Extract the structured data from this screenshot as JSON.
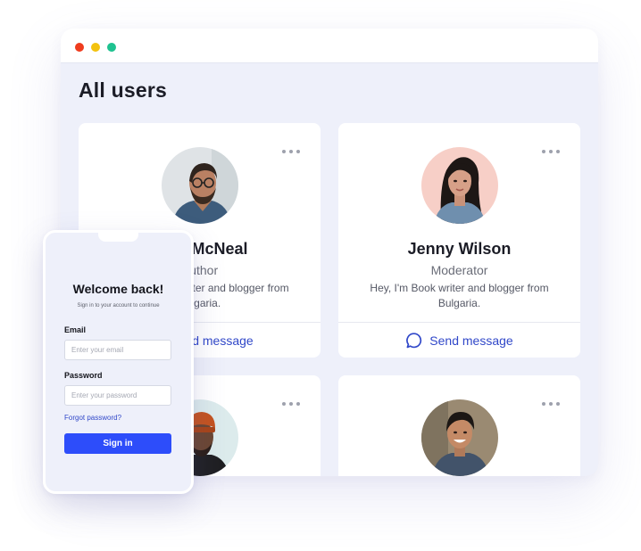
{
  "window": {
    "controls": {
      "close_color": "#ef3c1e",
      "minimize_color": "#f3c20f",
      "maximize_color": "#1fc290"
    },
    "title": "All users"
  },
  "users": [
    {
      "name": "Jack McNeal",
      "role": "Author",
      "bio": "Hey, I'm Book writer and blogger from Bulgaria.",
      "action": "Send message",
      "avatar_bg": "#dfe3e6",
      "more_icon": "more-horizontal-icon"
    },
    {
      "name": "Jenny Wilson",
      "role": "Moderator",
      "bio": "Hey, I'm Book writer and blogger from Bulgaria.",
      "action": "Send message",
      "avatar_bg": "#f7cfc7",
      "more_icon": "more-horizontal-icon"
    },
    {
      "avatar_bg": "#dcebec",
      "more_icon": "more-horizontal-icon"
    },
    {
      "avatar_bg": "#9a8a72",
      "more_icon": "more-horizontal-icon"
    }
  ],
  "login": {
    "title": "Welcome back!",
    "subtitle": "Sign in to your account to continue",
    "email_label": "Email",
    "email_placeholder": "Enter your email",
    "password_label": "Password",
    "password_placeholder": "Enter your password",
    "forgot_link": "Forgot password?",
    "submit_label": "Sign in"
  },
  "colors": {
    "accent": "#3148c9",
    "primary_button": "#2d4dfa",
    "page_bg": "#eef0fa"
  }
}
